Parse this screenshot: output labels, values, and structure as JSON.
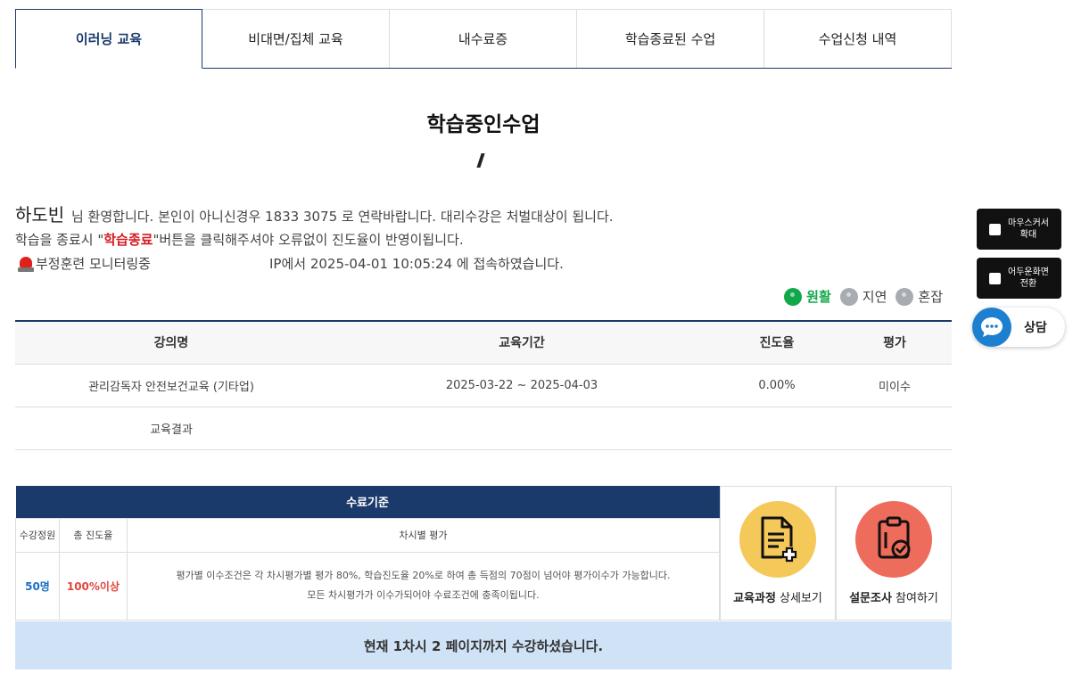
{
  "tabs": [
    {
      "label": "이러닝 교육",
      "active": true
    },
    {
      "label": "비대면/집체 교육",
      "active": false
    },
    {
      "label": "내수료증",
      "active": false
    },
    {
      "label": "학습종료된 수업",
      "active": false
    },
    {
      "label": "수업신청 내역",
      "active": false
    }
  ],
  "page_title": "학습중인수업",
  "welcome": {
    "name": "하도빈",
    "message": "님 환영합니다. 본인이 아니신경우 1833 3075 로 연락바랍니다. 대리수강은 처벌대상이 됩니다."
  },
  "notice": {
    "before": "학습을 종료시 \"",
    "highlight": "학습종료",
    "after": "\"버튼을 클릭해주셔야 오류없이 진도율이 반영이됩니다."
  },
  "monitoring": {
    "label": "부정훈련 모니터링중",
    "ip_message": "IP에서 2025-04-01 10:05:24 에 접속하였습니다."
  },
  "status_legend": {
    "smooth": "원활",
    "delay": "지연",
    "busy": "혼잡",
    "smooth_color": "#11a84a",
    "inactive_color": "#a6acb2"
  },
  "course_table": {
    "headers": [
      "강의명",
      "교육기간",
      "진도율",
      "평가"
    ],
    "row": {
      "name": "관리감독자 안전보건교육 (기타업)",
      "period": "2025-03-22 ~ 2025-04-03",
      "progress": "0.00%",
      "evaluation": "미이수"
    },
    "result_label": "교육결과"
  },
  "criteria": {
    "title": "수료기준",
    "headers": [
      "수강정원",
      "총 진도율",
      "차시별 평가"
    ],
    "capacity": "50명",
    "total_progress": "100%이상",
    "desc_line1": "평가별 이수조건은 각 차시평가별 평가 80%, 학습진도율 20%로 하여 총 득점의 70점이 넘어야 평가이수가 가능합니다.",
    "desc_line2": "모든 차시평가가 이수가되어야 수료조건에 충족이됩니다."
  },
  "actions": {
    "course_detail_bold": "교육과정",
    "course_detail_rest": " 상세보기",
    "survey_bold": "설문조사",
    "survey_rest": " 참여하기",
    "course_color": "#f5c85a",
    "survey_color": "#ee6c5c"
  },
  "progress_banner": "현재 1차시 2 페이지까지 수강하셨습니다.",
  "side": {
    "cursor_zoom": [
      "마우스커서",
      "확대"
    ],
    "dark_mode": [
      "어두운화면",
      "전환"
    ],
    "chat_label": "상담",
    "chat_color": "#1c7fd0"
  }
}
